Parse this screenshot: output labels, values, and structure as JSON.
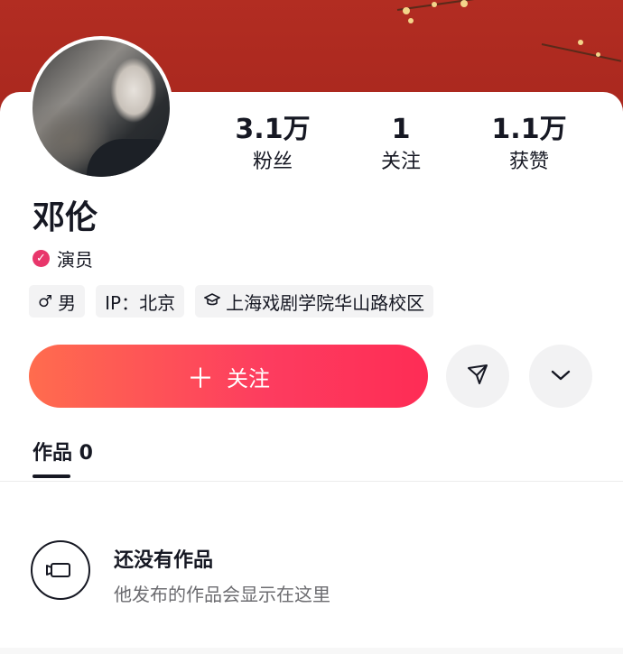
{
  "profile": {
    "name": "邓伦",
    "verification": "演员",
    "stats": [
      {
        "value": "3.1万",
        "label": "粉丝"
      },
      {
        "value": "1",
        "label": "关注"
      },
      {
        "value": "1.1万",
        "label": "获赞"
      }
    ],
    "tags": {
      "gender": "男",
      "ip": "IP：北京",
      "school": "上海戏剧学院华山路校区"
    }
  },
  "actions": {
    "follow_label": "关注",
    "follow_plus": "＋"
  },
  "tabs": {
    "works_label": "作品 0"
  },
  "empty_state": {
    "title": "还没有作品",
    "subtitle": "他发布的作品会显示在这里"
  },
  "colors": {
    "banner": "#b22d22",
    "follow_start": "#ff6c4e",
    "follow_end": "#fe2c55",
    "verify_badge": "#e8366b"
  },
  "icons": {
    "verify": "check-badge-icon",
    "gender": "male-icon",
    "school": "graduation-cap-icon",
    "share": "send-icon",
    "more": "chevron-down-icon",
    "empty": "video-camera-icon"
  }
}
